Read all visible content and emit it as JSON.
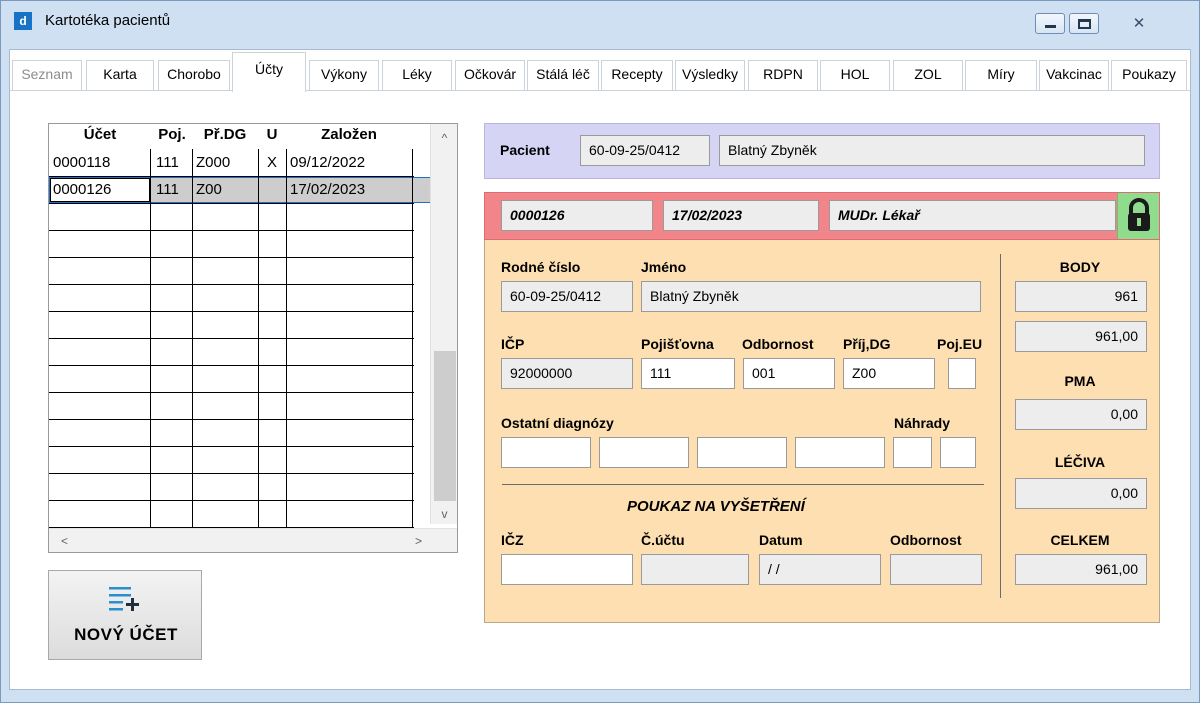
{
  "window": {
    "title": "Kartotéka pacientů",
    "icon": "app-icon",
    "icon_glyph": "d",
    "minimize_glyph": "",
    "maximize_glyph": "",
    "close_glyph": "✕"
  },
  "tabs": [
    {
      "label": "Seznam",
      "disabled": true
    },
    {
      "label": "Karta"
    },
    {
      "label": "Chorobo"
    },
    {
      "label": "Účty",
      "active": true
    },
    {
      "label": "Výkony"
    },
    {
      "label": "Léky"
    },
    {
      "label": "Očkovár"
    },
    {
      "label": "Stálá léč"
    },
    {
      "label": "Recepty"
    },
    {
      "label": "Výsledky"
    },
    {
      "label": "RDPN"
    },
    {
      "label": "HOL"
    },
    {
      "label": "ZOL"
    },
    {
      "label": "Míry"
    },
    {
      "label": "Vakcinac"
    },
    {
      "label": "Poukazy"
    }
  ],
  "accounts_grid": {
    "columns": [
      "Účet",
      "Poj.",
      "Př.DG",
      "U",
      "Založen"
    ],
    "rows": [
      {
        "ucet": "0000118",
        "poj": "111",
        "dg": "Z000",
        "u": "X",
        "zalozen": "09/12/2022"
      },
      {
        "ucet": "0000126",
        "poj": "111",
        "dg": "Z00",
        "u": "",
        "zalozen": "17/02/2023",
        "selected": true
      }
    ],
    "scroll_up": "^",
    "scroll_down": "v",
    "scroll_left": "<",
    "scroll_right": ">"
  },
  "new_account_button": {
    "label": "NOVÝ ÚČET",
    "icon": "add-list-icon"
  },
  "patient": {
    "label": "Pacient",
    "rc": "60-09-25/0412",
    "name": "Blatný Zbyněk"
  },
  "account": {
    "number": "0000126",
    "date": "17/02/2023",
    "doctor": "MUDr. Lékař",
    "lock_icon": "lock-icon",
    "lock_glyph": "🔒"
  },
  "form": {
    "rodne_cislo_label": "Rodné číslo",
    "rodne_cislo": "60-09-25/0412",
    "jmeno_label": "Jméno",
    "jmeno": "Blatný Zbyněk",
    "icp_label": "IČP",
    "icp": "92000000",
    "pojistovna_label": "Pojišťovna",
    "pojistovna": "111",
    "odbornost_label": "Odbornost",
    "odbornost": "001",
    "prij_dg_label": "Příj,DG",
    "prij_dg": "Z00",
    "poj_eu_label": "Poj.EU",
    "poj_eu": "",
    "ostatni_label": "Ostatní diagnózy",
    "nahrady_label": "Náhrady",
    "poukaz_title": "POUKAZ NA VYŠETŘENÍ",
    "icz_label": "IČZ",
    "icz": "",
    "c_uctu_label": "Č.účtu",
    "c_uctu": "",
    "datum_label": "Datum",
    "datum": " / /",
    "odbornost2_label": "Odbornost",
    "odbornost2": ""
  },
  "totals": {
    "body_label": "BODY",
    "body": "961",
    "body_kc": "961,00",
    "pma_label": "PMA",
    "pma": "0,00",
    "leciva_label": "LÉČIVA",
    "leciva": "0,00",
    "celkem_label": "CELKEM",
    "celkem": "961,00"
  }
}
